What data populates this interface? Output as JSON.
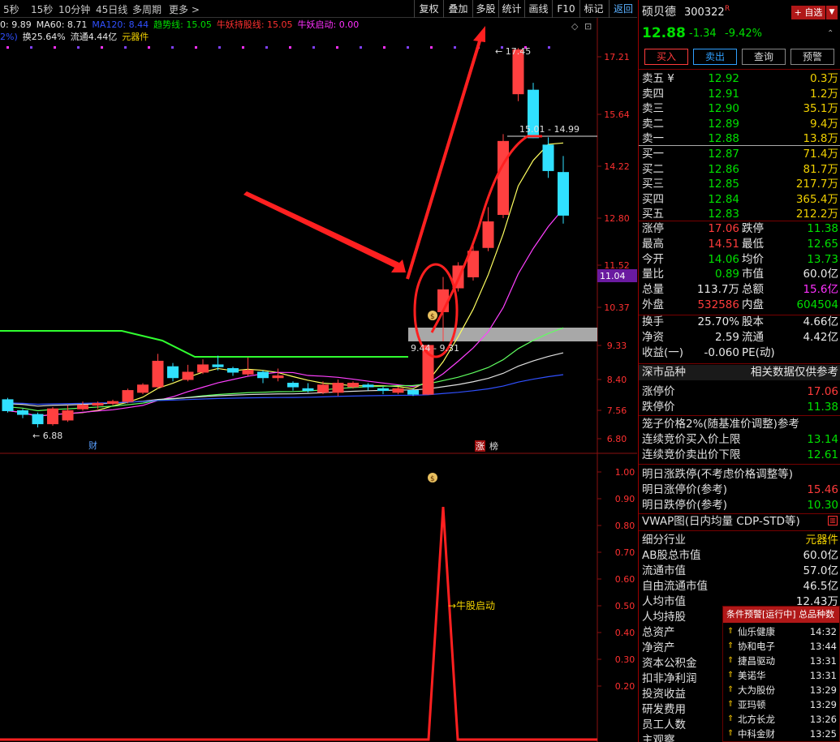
{
  "toolbar": {
    "periods": [
      "5秒",
      "15秒",
      "10分钟",
      "45日线",
      "多周期",
      "更多 >"
    ],
    "buttons": [
      "复权",
      "叠加",
      "多股",
      "统计",
      "画线",
      "F10",
      "标记",
      "返回"
    ]
  },
  "indicators_line1": [
    {
      "text": "0: 9.89",
      "color": "#e8e8e8"
    },
    {
      "text": "MA60: 8.71",
      "color": "#e8e8e8"
    },
    {
      "text": "MA120: 8.44",
      "color": "#3050ff"
    },
    {
      "text": "趋势线: 15.05",
      "color": "#00e000"
    },
    {
      "text": "牛妖持股线: 15.05",
      "color": "#ff3030"
    },
    {
      "text": "牛妖启动: 0.00",
      "color": "#ff30ff"
    }
  ],
  "indicators_line2": [
    {
      "text": "2%)",
      "color": "#3050ff"
    },
    {
      "text": "换25.64%",
      "color": "#e8e8e8"
    },
    {
      "text": "流通4.44亿",
      "color": "#e8e8e8"
    },
    {
      "text": "元器件",
      "color": "#f0d000"
    }
  ],
  "price_axis": [
    "17.21",
    "15.64",
    "14.22",
    "12.80",
    "11.52",
    "10.37",
    "9.33",
    "8.40",
    "7.56",
    "6.80"
  ],
  "current_price_tag": "11.04",
  "sub_axis": [
    "1.00",
    "0.90",
    "0.80",
    "0.70",
    "0.60",
    "0.50",
    "0.40",
    "0.30",
    "0.20"
  ],
  "chart_labels": {
    "high_marker": "17.45",
    "low_marker": "6.88",
    "range_marker": "15.01 - 14.99",
    "gap_marker": "9.44 - 9.31",
    "event_cai": "财",
    "event_zhang": "涨",
    "event_bang": "榜",
    "signal_label": "→牛股启动",
    "money_icon": "$"
  },
  "chart_data": {
    "type": "candlestick",
    "candles": [
      {
        "o": 7.85,
        "c": 7.55,
        "h": 7.9,
        "l": 7.5
      },
      {
        "o": 7.55,
        "c": 7.45,
        "h": 7.6,
        "l": 7.35
      },
      {
        "o": 7.45,
        "c": 7.2,
        "h": 7.5,
        "l": 7.1
      },
      {
        "o": 7.2,
        "c": 7.6,
        "h": 7.65,
        "l": 7.15
      },
      {
        "o": 7.3,
        "c": 7.55,
        "h": 7.7,
        "l": 7.25
      },
      {
        "o": 7.6,
        "c": 7.7,
        "h": 7.8,
        "l": 7.55
      },
      {
        "o": 7.7,
        "c": 7.75,
        "h": 7.8,
        "l": 7.6
      },
      {
        "o": 7.75,
        "c": 7.8,
        "h": 7.85,
        "l": 7.7
      },
      {
        "o": 7.8,
        "c": 8.1,
        "h": 8.15,
        "l": 7.75
      },
      {
        "o": 8.05,
        "c": 8.25,
        "h": 8.3,
        "l": 8.0
      },
      {
        "o": 8.2,
        "c": 8.9,
        "h": 9.1,
        "l": 8.15
      },
      {
        "o": 8.75,
        "c": 8.45,
        "h": 8.85,
        "l": 8.35
      },
      {
        "o": 8.4,
        "c": 8.6,
        "h": 8.8,
        "l": 8.35
      },
      {
        "o": 8.6,
        "c": 8.8,
        "h": 8.95,
        "l": 8.55
      },
      {
        "o": 8.8,
        "c": 8.75,
        "h": 9.05,
        "l": 8.65
      },
      {
        "o": 8.7,
        "c": 8.6,
        "h": 8.75,
        "l": 8.5
      },
      {
        "o": 8.55,
        "c": 8.65,
        "h": 9.0,
        "l": 8.5
      },
      {
        "o": 8.6,
        "c": 8.45,
        "h": 8.65,
        "l": 8.3
      },
      {
        "o": 8.45,
        "c": 8.5,
        "h": 8.7,
        "l": 8.35
      },
      {
        "o": 8.3,
        "c": 8.2,
        "h": 8.35,
        "l": 8.1
      },
      {
        "o": 8.15,
        "c": 8.1,
        "h": 8.3,
        "l": 8.05
      },
      {
        "o": 8.05,
        "c": 8.25,
        "h": 8.35,
        "l": 8.0
      },
      {
        "o": 8.05,
        "c": 8.3,
        "h": 8.4,
        "l": 7.95
      },
      {
        "o": 8.2,
        "c": 8.3,
        "h": 8.35,
        "l": 8.15
      },
      {
        "o": 8.25,
        "c": 8.2,
        "h": 8.3,
        "l": 8.1
      },
      {
        "o": 8.15,
        "c": 8.1,
        "h": 8.2,
        "l": 8.0
      },
      {
        "o": 8.05,
        "c": 8.15,
        "h": 8.2,
        "l": 8.0
      },
      {
        "o": 8.1,
        "c": 8.0,
        "h": 8.15,
        "l": 7.95
      },
      {
        "o": 8.0,
        "c": 9.33,
        "h": 9.33,
        "l": 7.98
      },
      {
        "o": 10.25,
        "c": 10.85,
        "h": 11.2,
        "l": 9.44
      },
      {
        "o": 10.9,
        "c": 11.5,
        "h": 11.6,
        "l": 10.8
      },
      {
        "o": 11.2,
        "c": 11.9,
        "h": 12.1,
        "l": 11.1
      },
      {
        "o": 12.0,
        "c": 12.7,
        "h": 13.1,
        "l": 11.9
      },
      {
        "o": 12.9,
        "c": 14.9,
        "h": 15.1,
        "l": 12.8
      },
      {
        "o": 16.2,
        "c": 17.4,
        "h": 17.45,
        "l": 16.0
      },
      {
        "o": 16.3,
        "c": 15.0,
        "h": 16.5,
        "l": 14.99
      },
      {
        "o": 14.8,
        "c": 14.1,
        "h": 15.01,
        "l": 13.9
      },
      {
        "o": 14.05,
        "c": 12.88,
        "h": 14.5,
        "l": 12.65
      }
    ],
    "signal_series": {
      "name": "牛股启动",
      "peak_value": 1.0,
      "peak_index": 29
    },
    "ylim": [
      6.6,
      17.8
    ],
    "sub_ylim": [
      0,
      1.05
    ]
  },
  "quote": {
    "name": "硕贝德",
    "code": "300322",
    "flag": "R",
    "add_watch_label": "+ 自选",
    "price": "12.88",
    "change": "-1.34",
    "change_pct": "-9.42%",
    "buttons": [
      "买入",
      "卖出",
      "查询",
      "预警"
    ],
    "asks": [
      {
        "label": "卖五 ¥",
        "price": "12.92",
        "vol": "0.3万"
      },
      {
        "label": "卖四",
        "price": "12.91",
        "vol": "1.2万"
      },
      {
        "label": "卖三",
        "price": "12.90",
        "vol": "35.1万"
      },
      {
        "label": "卖二",
        "price": "12.89",
        "vol": "9.4万"
      },
      {
        "label": "卖一",
        "price": "12.88",
        "vol": "13.8万"
      }
    ],
    "bids": [
      {
        "label": "买一",
        "price": "12.87",
        "vol": "71.4万"
      },
      {
        "label": "买二",
        "price": "12.86",
        "vol": "81.7万"
      },
      {
        "label": "买三",
        "price": "12.85",
        "vol": "217.7万"
      },
      {
        "label": "买四",
        "price": "12.84",
        "vol": "365.4万"
      },
      {
        "label": "买五",
        "price": "12.83",
        "vol": "212.2万"
      }
    ],
    "stats": [
      {
        "l1": "涨停",
        "v1": "17.06",
        "c1": "red",
        "l2": "跌停",
        "v2": "11.38",
        "c2": "grn"
      },
      {
        "l1": "最高",
        "v1": "14.51",
        "c1": "red",
        "l2": "最低",
        "v2": "12.65",
        "c2": "grn"
      },
      {
        "l1": "今开",
        "v1": "14.06",
        "c1": "grn",
        "l2": "均价",
        "v2": "13.73",
        "c2": "grn"
      },
      {
        "l1": "量比",
        "v1": "0.89",
        "c1": "grn",
        "l2": "市值",
        "v2": "60.0亿",
        "c2": "wht"
      },
      {
        "l1": "总量",
        "v1": "113.7万",
        "c1": "wht",
        "l2": "总额",
        "v2": "15.6亿",
        "c2": "mag"
      },
      {
        "l1": "外盘",
        "v1": "532586",
        "c1": "red",
        "l2": "内盘",
        "v2": "604504",
        "c2": "grn"
      }
    ],
    "stats2": [
      {
        "l1": "换手",
        "v1": "25.70%",
        "c1": "wht",
        "l2": "股本",
        "v2": "4.66亿",
        "c2": "wht"
      },
      {
        "l1": "净资",
        "v1": "2.59",
        "c1": "wht",
        "l2": "流通",
        "v2": "4.42亿",
        "c2": "wht"
      },
      {
        "l1": "收益(一)",
        "v1": "-0.060",
        "c1": "wht",
        "l2": "PE(动)",
        "v2": "",
        "c2": "wht"
      }
    ],
    "market_section": {
      "title": "深市品种",
      "note": "相关数据仅供参考"
    },
    "limit_up_label": "涨停价",
    "limit_up_val": "17.06",
    "limit_down_label": "跌停价",
    "limit_down_val": "11.38",
    "cage_title": "笼子价格2%(随基准价调整)参考",
    "auction_buy_label": "连续竞价买入价上限",
    "auction_buy_val": "13.14",
    "auction_sell_label": "连续竞价卖出价下限",
    "auction_sell_val": "12.61",
    "tomorrow_title": "明日涨跌停(不考虑价格调整等)",
    "tomorrow_up_label": "明日涨停价(参考)",
    "tomorrow_up_val": "15.46",
    "tomorrow_down_label": "明日跌停价(参考)",
    "tomorrow_down_val": "10.30",
    "vwap_title": "VWAP图(日内均量 CDP-STD等)",
    "fundamentals": [
      {
        "label": "细分行业",
        "value": "元器件",
        "color": "yel"
      },
      {
        "label": "AB股总市值",
        "value": "60.0亿",
        "color": "wht"
      },
      {
        "label": "流通市值",
        "value": "57.0亿",
        "color": "wht"
      },
      {
        "label": "自由流通市值",
        "value": "46.5亿",
        "color": "wht"
      },
      {
        "label": "人均市值",
        "value": "12.43万",
        "color": "wht"
      },
      {
        "label": "人均持股",
        "value": "",
        "color": "wht"
      },
      {
        "label": "总资产",
        "value": "",
        "color": "wht"
      },
      {
        "label": "净资产",
        "value": "",
        "color": "wht"
      },
      {
        "label": "资本公积金",
        "value": "",
        "color": "wht"
      },
      {
        "label": "扣非净利润",
        "value": "",
        "color": "wht"
      },
      {
        "label": "投资收益",
        "value": "",
        "color": "wht"
      },
      {
        "label": "研发费用",
        "value": "",
        "color": "wht"
      },
      {
        "label": "员工人数",
        "value": "",
        "color": "wht"
      },
      {
        "label": "主观察",
        "value": "",
        "color": "wht"
      }
    ]
  },
  "alerts": {
    "header": "条件预警[运行中] 总品种数",
    "items": [
      {
        "name": "仙乐健康",
        "time": "14:32"
      },
      {
        "name": "协和电子",
        "time": "13:44"
      },
      {
        "name": "捷昌驱动",
        "time": "13:31"
      },
      {
        "name": "美诺华",
        "time": "13:31"
      },
      {
        "name": "大为股份",
        "time": "13:29"
      },
      {
        "name": "亚玛顿",
        "time": "13:29"
      },
      {
        "name": "北方长龙",
        "time": "13:26"
      },
      {
        "name": "中科金财",
        "time": "13:25"
      }
    ]
  }
}
